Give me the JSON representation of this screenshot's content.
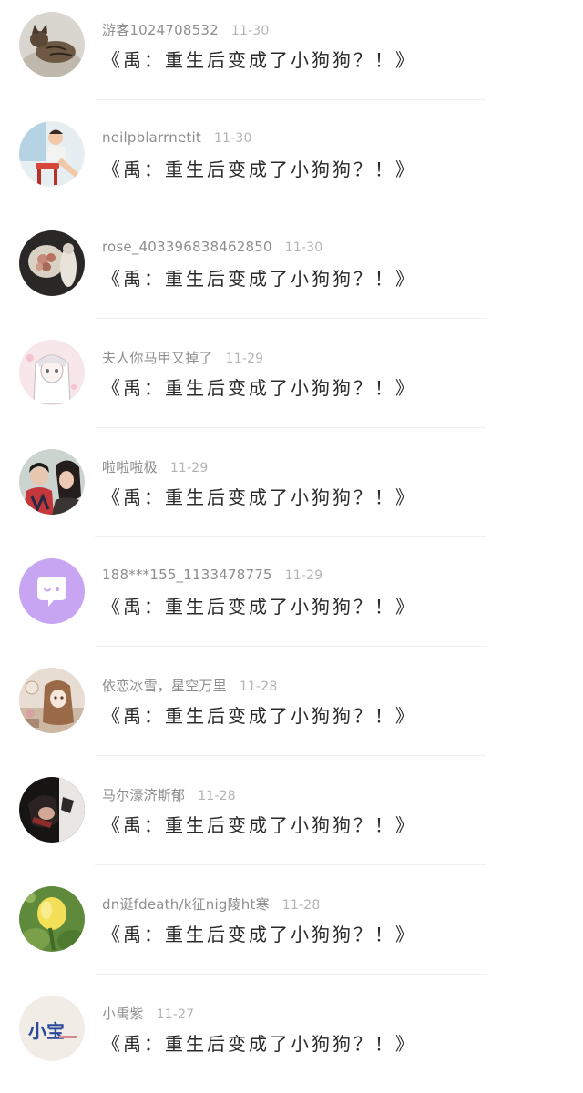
{
  "comments": [
    {
      "user": "游客1024708532",
      "time": "11-30",
      "text": "《禹：重生后变成了小狗狗？！》",
      "avatar": "cat-photo-avatar"
    },
    {
      "user": "neilpblarrnetit",
      "time": "11-30",
      "text": "《禹：重生后变成了小狗狗？！》",
      "avatar": "pinup-illustration-avatar"
    },
    {
      "user": "rose_403396838462850",
      "time": "11-30",
      "text": "《禹：重生后变成了小狗狗？！》",
      "avatar": "flower-bouquet-avatar"
    },
    {
      "user": "夫人你马甲又掉了",
      "time": "11-29",
      "text": "《禹：重生后变成了小狗狗？！》",
      "avatar": "anime-girl-avatar"
    },
    {
      "user": "啦啦啦极",
      "time": "11-29",
      "text": "《禹：重生后变成了小狗狗？！》",
      "avatar": "couple-photo-avatar"
    },
    {
      "user": "188***155_1133478775",
      "time": "11-29",
      "text": "《禹：重生后变成了小狗狗？！》",
      "avatar": "default-chat-bubble-avatar"
    },
    {
      "user": "依恋冰雪，星空万里",
      "time": "11-28",
      "text": "《禹：重生后变成了小狗狗？！》",
      "avatar": "doll-illustration-avatar"
    },
    {
      "user": "马尔濠济斯郁",
      "time": "11-28",
      "text": "《禹：重生后变成了小狗狗？！》",
      "avatar": "dark-portrait-avatar"
    },
    {
      "user": "dn诞fdeath/k征nig陵ht寒",
      "time": "11-28",
      "text": "《禹：重生后变成了小狗狗？！》",
      "avatar": "yellow-flower-avatar"
    },
    {
      "user": "小禹紫",
      "time": "11-27",
      "text": "《禹：重生后变成了小狗狗？！》",
      "avatar": "xiaobao-logo-avatar"
    }
  ],
  "avatar_logo_text": "小宝",
  "colors": {
    "username": "#8e8e8e",
    "time": "#b4b4b4",
    "comment": "#2a2a2a",
    "divider": "#efefef",
    "default_avatar_bg": "#c7a5f2"
  }
}
